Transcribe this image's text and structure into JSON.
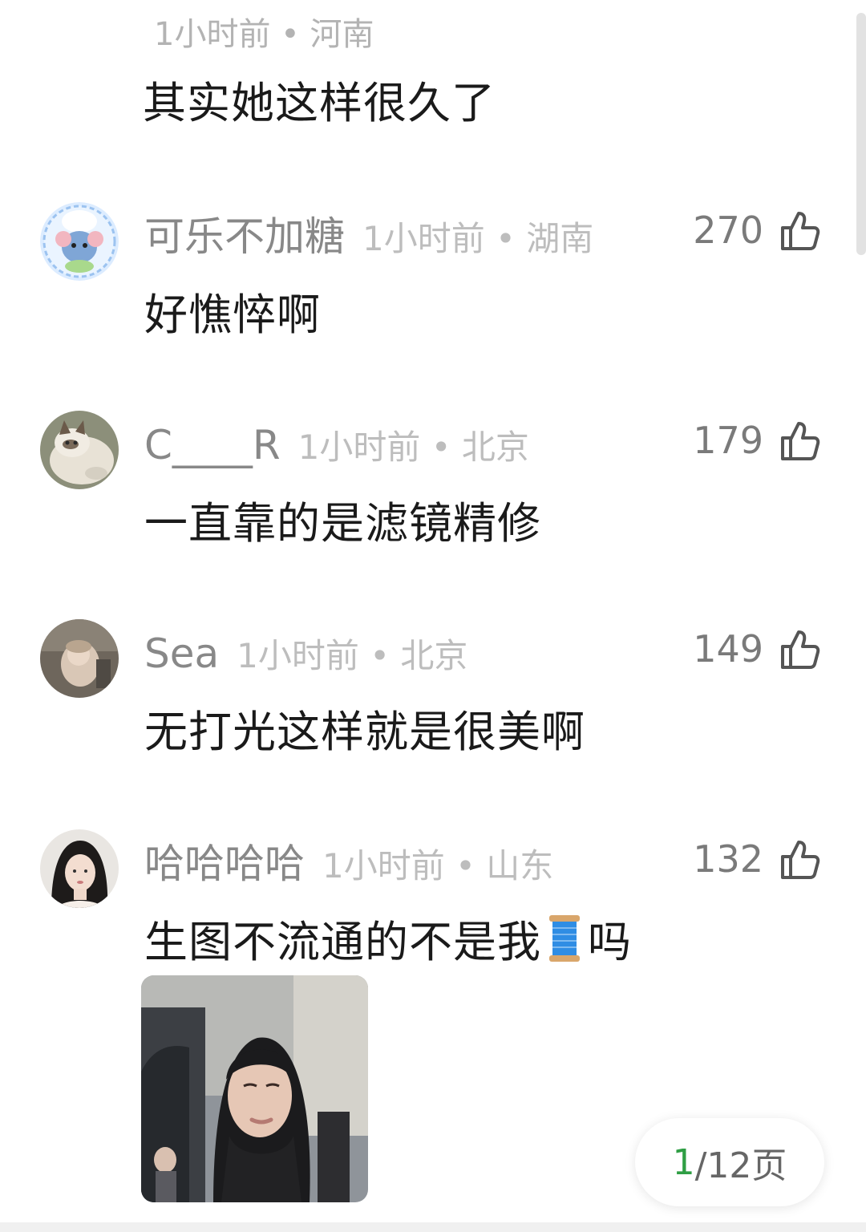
{
  "partial_comment": {
    "meta": "1小时前 • 河南",
    "text": "其实她这样很久了"
  },
  "comments": [
    {
      "name": "可乐不加糖",
      "meta": "1小时前 • 湖南",
      "likes": "270",
      "text": "好憔悴啊"
    },
    {
      "name": "C____R",
      "meta": "1小时前 • 北京",
      "likes": "179",
      "text": "一直靠的是滤镜精修"
    },
    {
      "name": "Sea",
      "meta": "1小时前 • 北京",
      "likes": "149",
      "text": "无打光这样就是很美啊"
    },
    {
      "name": "哈哈哈哈",
      "meta": "1小时前 • 山东",
      "likes": "132",
      "text_before": "生图不流通的不是我",
      "text_after": "吗",
      "emoji": "spool-of-thread-emoji"
    }
  ],
  "pager": {
    "current": "1",
    "total": "/12页"
  },
  "colors": {
    "accent": "#2f9e44",
    "meta": "#bdbdbd",
    "name": "#888888"
  }
}
